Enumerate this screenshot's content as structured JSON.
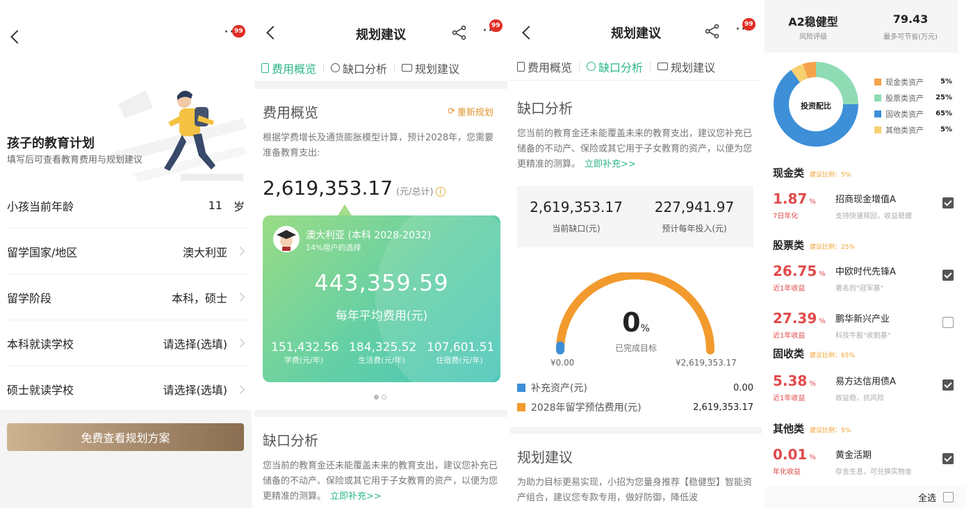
{
  "badge_count": "99",
  "s1": {
    "title": "孩子的教育计划",
    "subtitle": "填写后可查看教育费用与规划建议",
    "rows": [
      {
        "label": "小孩当前年龄",
        "value": "11",
        "unit": "岁"
      },
      {
        "label": "留学国家/地区",
        "value": "澳大利亚"
      },
      {
        "label": "留学阶段",
        "value": "本科，硕士"
      },
      {
        "label": "本科就读学校",
        "value": "请选择(选填)"
      },
      {
        "label": "硕士就读学校",
        "value": "请选择(选填)"
      }
    ],
    "cta": "免费查看规划方案"
  },
  "nav_title": "规划建议",
  "tabs": [
    "费用概览",
    "缺口分析",
    "规划建议"
  ],
  "s2": {
    "section_title": "费用概览",
    "replan": "重新规划",
    "desc": "根据学费增长及通货膨胀模型计算，预计2028年，您需要准备教育支出:",
    "total": "2,619,353.17",
    "total_unit": "(元/总计)",
    "card": {
      "title": "澳大利亚 (本科 2028-2032)",
      "sub": "14%用户的选择",
      "avg": "443,359.59",
      "avg_label": "每年平均费用(元)",
      "items": [
        {
          "value": "151,432.56",
          "label": "学费(元/年)"
        },
        {
          "value": "184,325.52",
          "label": "生活费(元/年)"
        },
        {
          "value": "107,601.51",
          "label": "住宿费(元/年)"
        }
      ]
    },
    "gap_title": "缺口分析",
    "gap_desc": "您当前的教育金还未能覆盖未来的教育支出，建议您补充已储备的不动产、保险或其它用于子女教育的资产，以便为您更精准的测算。",
    "gap_link": "立即补充>>"
  },
  "s3": {
    "section_title": "缺口分析",
    "desc": "您当前的教育金还未能覆盖未来的教育支出，建议您补充已储备的不动产、保险或其它用于子女教育的资产，以便为您更精准的测算。",
    "link": "立即补充>>",
    "gap_value": "2,619,353.17",
    "gap_label": "当前缺口(元)",
    "annual_value": "227,941.97",
    "annual_label": "预计每年投入(元)",
    "gauge_pct": "0",
    "gauge_pct_unit": "%",
    "gauge_label": "已完成目标",
    "gauge_min": "¥0.00",
    "gauge_max": "¥2,619,353.17",
    "gauge_fraction": 0.0,
    "legend": [
      {
        "label": "补充资产(元)",
        "value": "0.00",
        "color": "#3d8fd8"
      },
      {
        "label": "2028年留学预估费用(元)",
        "value": "2,619,353.17",
        "color": "#f29a2e"
      }
    ],
    "plan_title": "规划建议",
    "plan_desc": "为助力目标更易实现，小招为您量身推荐【稳健型】智能资产组合，建议您专款专用，做好防御，降低波"
  },
  "s4": {
    "risk": "A2稳健型",
    "risk_label": "风险评级",
    "save": "79.43",
    "save_label": "最多可节省(万元)",
    "donut_label": "投资配比",
    "alloc": [
      {
        "label": "现金类资产",
        "pct": "5%",
        "value": 5,
        "color": "#f5a34a"
      },
      {
        "label": "股票类资产",
        "pct": "25%",
        "value": 25,
        "color": "#8fdcb4"
      },
      {
        "label": "固收类资产",
        "pct": "65%",
        "value": 65,
        "color": "#3d8fd8"
      },
      {
        "label": "其他类资产",
        "pct": "5%",
        "value": 5,
        "color": "#f7d070"
      }
    ],
    "categories": [
      {
        "title": "现金类",
        "hint": "建议比例：5%",
        "funds": [
          {
            "value": "1.87",
            "unit": "%",
            "sub": "7日年化",
            "name": "招商现金增值A",
            "desc": "支持快速赎回，收益稳健",
            "checked": true
          }
        ]
      },
      {
        "title": "股票类",
        "hint": "建议比例：25%",
        "funds": [
          {
            "value": "26.75",
            "unit": "%",
            "sub": "近1年收益",
            "name": "中欧时代先锋A",
            "desc": "著名的\"冠军基\"",
            "checked": true
          },
          {
            "value": "27.39",
            "unit": "%",
            "sub": "近1年收益",
            "name": "鹏华新兴产业",
            "desc": "科技牛股\"收割基\"",
            "checked": false
          }
        ]
      },
      {
        "title": "固收类",
        "hint": "建议比例：65%",
        "funds": [
          {
            "value": "5.38",
            "unit": "%",
            "sub": "近1年收益",
            "name": "易方达信用债A",
            "desc": "收益稳，抗风险",
            "checked": true
          }
        ]
      },
      {
        "title": "其他类",
        "hint": "建议比例：5%",
        "funds": [
          {
            "value": "0.01",
            "unit": "%",
            "sub": "年化收益",
            "name": "黄金活期",
            "desc": "存金生息，可兑换实物金",
            "checked": true
          }
        ]
      }
    ],
    "select_all": "全选"
  }
}
